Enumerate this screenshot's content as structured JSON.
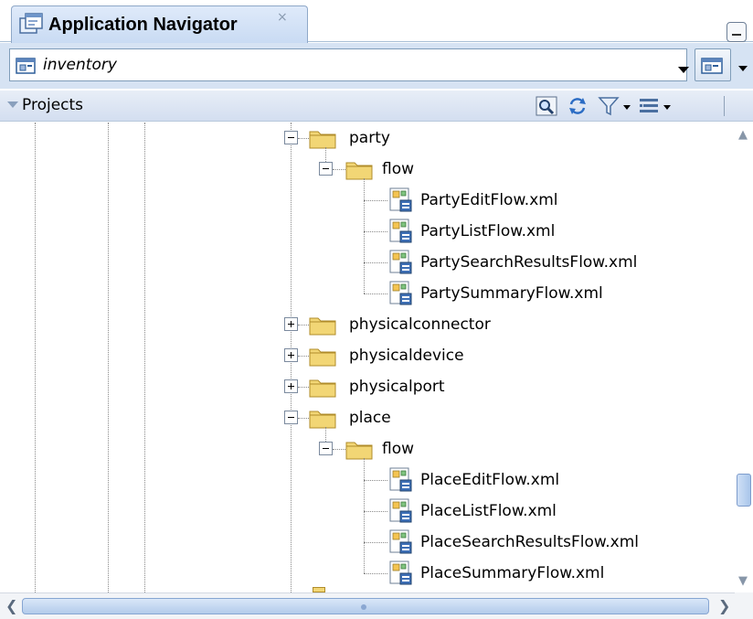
{
  "tab": {
    "title": "Application Navigator",
    "close_glyph": "×",
    "icon": "application-navigator-icon"
  },
  "application": {
    "name": "inventory",
    "icon": "application-icon"
  },
  "projects": {
    "label": "Projects",
    "toolbar_icons": [
      "find-icon",
      "refresh-icon",
      "filter-icon",
      "sort-options-icon"
    ]
  },
  "tree": [
    {
      "label": "party",
      "type": "folder",
      "state": "expanded"
    },
    {
      "label": "flow",
      "type": "folder",
      "state": "expanded"
    },
    {
      "label": "PartyEditFlow.xml",
      "type": "file"
    },
    {
      "label": "PartyListFlow.xml",
      "type": "file"
    },
    {
      "label": "PartySearchResultsFlow.xml",
      "type": "file"
    },
    {
      "label": "PartySummaryFlow.xml",
      "type": "file"
    },
    {
      "label": "physicalconnector",
      "type": "folder",
      "state": "collapsed"
    },
    {
      "label": "physicaldevice",
      "type": "folder",
      "state": "collapsed"
    },
    {
      "label": "physicalport",
      "type": "folder",
      "state": "collapsed"
    },
    {
      "label": "place",
      "type": "folder",
      "state": "expanded"
    },
    {
      "label": "flow",
      "type": "folder",
      "state": "expanded"
    },
    {
      "label": "PlaceEditFlow.xml",
      "type": "file"
    },
    {
      "label": "PlaceListFlow.xml",
      "type": "file"
    },
    {
      "label": "PlaceSearchResultsFlow.xml",
      "type": "file"
    },
    {
      "label": "PlaceSummaryFlow.xml",
      "type": "file"
    }
  ],
  "colors": {
    "folder": "#f2d675",
    "tab_bg": "#c9dbf3",
    "selector_bg": "#d6e3f3"
  }
}
